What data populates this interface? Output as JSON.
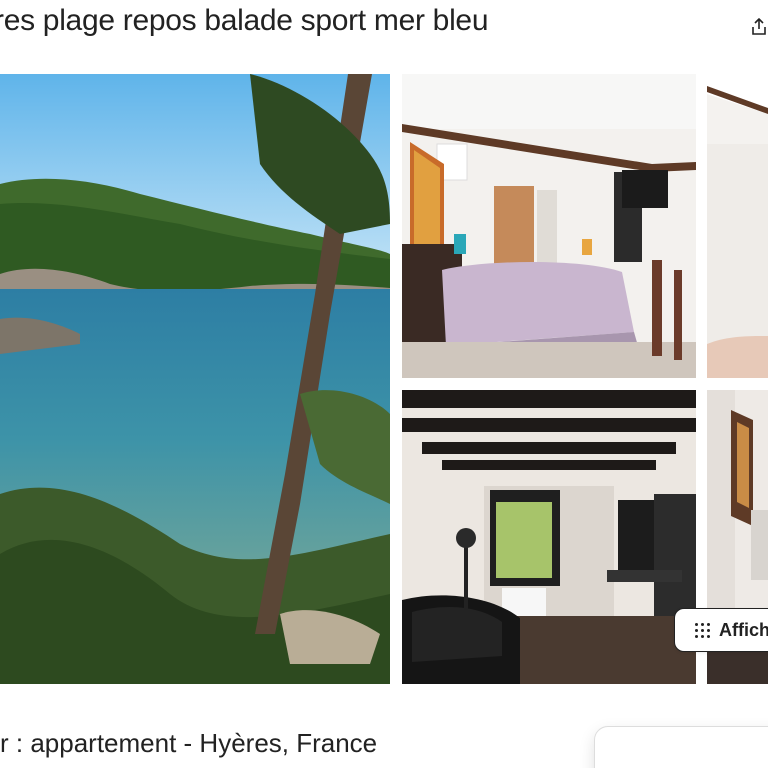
{
  "listing": {
    "title": "res plage repos balade sport mer bleu",
    "subtitle": "r : appartement - Hyères, France"
  },
  "actions": {
    "share_icon": "share-upload-icon",
    "show_all_label": "Affich"
  },
  "gallery": {
    "photos": [
      "coastal-sea-view-photo",
      "bedroom-photo",
      "partial-room-photo",
      "living-room-photo",
      "partial-hallway-photo"
    ]
  },
  "colors": {
    "text": "#222222",
    "sea": "#2f7fa0",
    "sky": "#7fc3ea",
    "bed": "#c9b6cf"
  }
}
